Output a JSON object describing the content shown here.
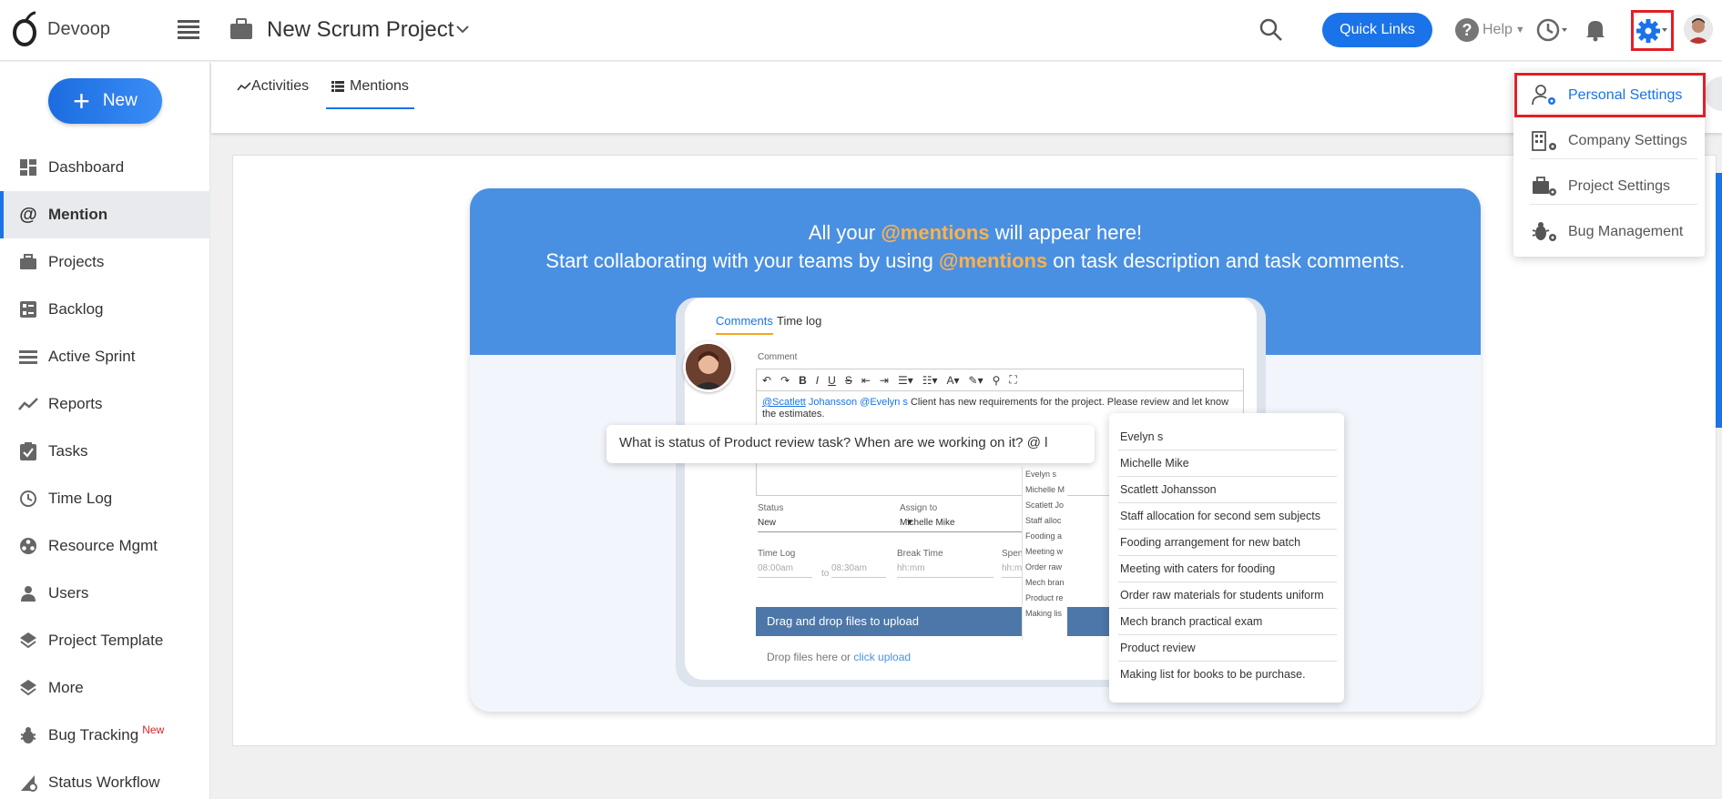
{
  "app": {
    "name": "Devoop"
  },
  "header": {
    "project_title": "New Scrum Project",
    "quick_links_label": "Quick Links",
    "help_label": "Help",
    "accent_color": "#1a73e8"
  },
  "sidebar": {
    "new_label": "New",
    "items": [
      {
        "label": "Dashboard",
        "icon": "dashboard-icon"
      },
      {
        "label": "Mention",
        "icon": "at-icon",
        "active": true
      },
      {
        "label": "Projects",
        "icon": "briefcase-icon"
      },
      {
        "label": "Backlog",
        "icon": "backlog-icon"
      },
      {
        "label": "Active Sprint",
        "icon": "sprint-icon"
      },
      {
        "label": "Reports",
        "icon": "trend-icon"
      },
      {
        "label": "Tasks",
        "icon": "task-icon"
      },
      {
        "label": "Time Log",
        "icon": "clock-icon"
      },
      {
        "label": "Resource Mgmt",
        "icon": "resource-icon"
      },
      {
        "label": "Users",
        "icon": "user-icon"
      },
      {
        "label": "Project Template",
        "icon": "layers-icon"
      },
      {
        "label": "More",
        "icon": "layers-icon"
      },
      {
        "label": "Bug Tracking",
        "icon": "bug-icon",
        "badge": "New"
      },
      {
        "label": "Status Workflow",
        "icon": "workflow-icon"
      }
    ]
  },
  "tabs": [
    {
      "label": "Activities",
      "icon": "activity-icon"
    },
    {
      "label": "Mentions",
      "icon": "list-icon",
      "active": true
    }
  ],
  "banner": {
    "line1_prefix": "All your ",
    "line1_highlight": "@mentions",
    "line1_suffix": " will appear here!",
    "line2_prefix": "Start collaborating with your teams by using ",
    "line2_highlight": "@mentions",
    "line2_suffix": " on task description and task comments."
  },
  "mockup": {
    "tab_comments": "Comments",
    "tab_timelog": "Time log",
    "comment_label": "Comment",
    "comment_mention1_a": "@Scatlett",
    "comment_mention1_b": " Johansson",
    "comment_mention2": " @Evelyn s",
    "comment_text": " Client has new requirements for the project. Please review and let know the estimates.",
    "status_label": "Status",
    "status_value": "New",
    "assign_label": "Assign to",
    "assign_value": "Michelle Mike",
    "timelog_label": "Time Log",
    "time_from": "08:00am",
    "time_to_word": "to",
    "time_to": "08:30am",
    "break_label": "Break Time",
    "break_placeholder": "hh:mm",
    "spent_label": "Spent",
    "spent_placeholder": "hh:mm",
    "upload_label": "Drag and drop files to upload",
    "drop_prefix": "Drop files here or ",
    "drop_link": "click upload",
    "bubble_text": "What is status of Product review task? When are we working on it? @ l"
  },
  "suggestions": [
    "Evelyn s",
    "Michelle Mike",
    "Scatlett Johansson",
    "Staff allocation for second sem subjects",
    "Fooding arrangement for new batch",
    "Meeting with caters for fooding",
    "Order raw materials for students uniform",
    "Mech branch practical exam",
    "Product review",
    "Making list for books to be purchase."
  ],
  "settings_menu": {
    "items": [
      {
        "label": "Personal Settings",
        "icon": "user-gear-icon",
        "active": true
      },
      {
        "label": "Company Settings",
        "icon": "building-gear-icon"
      },
      {
        "label": "Project Settings",
        "icon": "briefcase-gear-icon"
      },
      {
        "label": "Bug Management",
        "icon": "bug-gear-icon"
      }
    ]
  }
}
